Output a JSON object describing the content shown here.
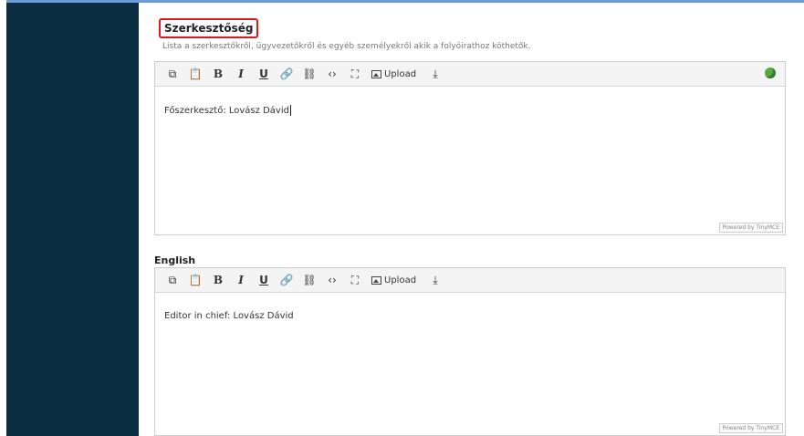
{
  "section": {
    "title": "Szerkesztőség",
    "description": "Lista a szerkesztőkről, ügyvezetőkről és egyéb személyekről akik a folyóirathoz köthetők."
  },
  "toolbar": {
    "copy_icon": "⧉",
    "paste_icon": "📋",
    "bold": "B",
    "italic": "I",
    "underline": "U",
    "link": "🔗",
    "unlink": "⛓",
    "code": "‹›",
    "fullscreen": "⛶",
    "upload_label": "Upload",
    "download": "⤓"
  },
  "editors": [
    {
      "language": "",
      "content": "Főszerkesztő: Lovász Dávid",
      "powered_by": "Powered by TinyMCE"
    },
    {
      "language": "English",
      "content": "Editor in chief: Lovász Dávid",
      "powered_by": "Powered by TinyMCE"
    }
  ],
  "colors": {
    "sidebar": "#0b2d42",
    "highlight_border": "#e0191f",
    "globe": "#5aa941"
  }
}
